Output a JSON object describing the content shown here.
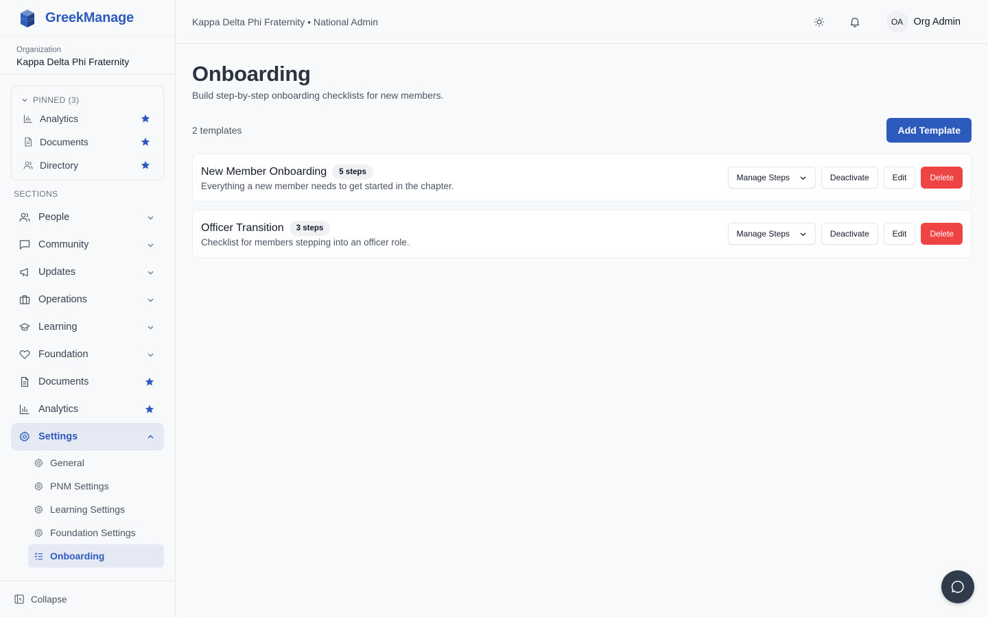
{
  "app": {
    "name": "GreekManage"
  },
  "org": {
    "label": "Organization",
    "name": "Kappa Delta Phi Fraternity"
  },
  "pinned": {
    "header": "PINNED (3)",
    "items": [
      {
        "label": "Analytics",
        "icon": "bar-chart-icon"
      },
      {
        "label": "Documents",
        "icon": "document-icon"
      },
      {
        "label": "Directory",
        "icon": "users-icon"
      }
    ]
  },
  "sections_label": "SECTIONS",
  "nav": {
    "items": [
      {
        "label": "People",
        "icon": "users-icon"
      },
      {
        "label": "Community",
        "icon": "chat-icon"
      },
      {
        "label": "Updates",
        "icon": "megaphone-icon"
      },
      {
        "label": "Operations",
        "icon": "briefcase-icon"
      },
      {
        "label": "Learning",
        "icon": "graduation-cap-icon"
      },
      {
        "label": "Foundation",
        "icon": "heart-icon"
      },
      {
        "label": "Documents",
        "icon": "document-icon"
      },
      {
        "label": "Analytics",
        "icon": "bar-chart-icon"
      },
      {
        "label": "Settings",
        "icon": "gear-icon"
      }
    ],
    "settings_sub": [
      {
        "label": "General"
      },
      {
        "label": "PNM Settings"
      },
      {
        "label": "Learning Settings"
      },
      {
        "label": "Foundation Settings"
      },
      {
        "label": "Onboarding"
      }
    ]
  },
  "collapse_label": "Collapse",
  "header": {
    "breadcrumb": "Kappa Delta Phi Fraternity • National Admin",
    "avatar_initials": "OA",
    "user_name": "Org Admin"
  },
  "page": {
    "title": "Onboarding",
    "subtitle": "Build step-by-step onboarding checklists for new members.",
    "count": "2 templates",
    "add_label": "Add Template"
  },
  "templates": [
    {
      "title": "New Member Onboarding",
      "badge": "5 steps",
      "description": "Everything a new member needs to get started in the chapter."
    },
    {
      "title": "Officer Transition",
      "badge": "3 steps",
      "description": "Checklist for members stepping into an officer role."
    }
  ],
  "actions": {
    "manage": "Manage Steps",
    "deactivate": "Deactivate",
    "edit": "Edit",
    "delete": "Delete"
  },
  "colors": {
    "accent": "#2d5bbd",
    "danger": "#ef4444",
    "fab": "#2f3b4a"
  }
}
